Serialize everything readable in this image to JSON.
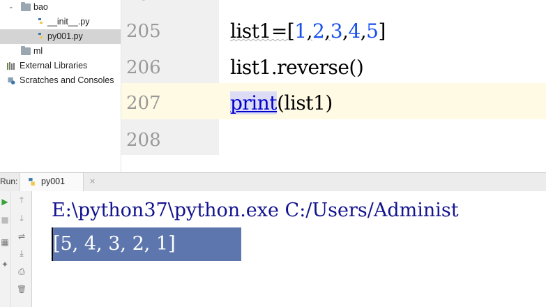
{
  "project_tree": {
    "items": [
      {
        "label": "bao",
        "kind": "folder"
      },
      {
        "label": "__init__.py",
        "kind": "py"
      },
      {
        "label": "py001.py",
        "kind": "py"
      },
      {
        "label": "ml",
        "kind": "folder"
      },
      {
        "label": "External Libraries",
        "kind": "libs"
      },
      {
        "label": "Scratches and Consoles",
        "kind": "scratch"
      }
    ]
  },
  "editor": {
    "lines": [
      {
        "number": "205",
        "tokens": [
          "list1=[",
          "1",
          ",",
          "2",
          ",",
          "3",
          ",",
          "4",
          ",",
          "5",
          "]"
        ]
      },
      {
        "number": "206",
        "text": "list1.reverse()"
      },
      {
        "number": "207",
        "builtin": "print",
        "rest": "(list1)"
      },
      {
        "number": "208",
        "text": ""
      }
    ],
    "colors": {
      "number": "#1750eb",
      "builtin": "#0000cc",
      "caret_line": "#fffae3"
    }
  },
  "run_window": {
    "label": "Run:",
    "tab_label": "py001",
    "tab_close": "×",
    "command": "E:\\python37\\python.exe C:/Users/Administ",
    "output": "[5, 4, 3, 2, 1]"
  },
  "icons": {
    "rerun": "▶",
    "stop": "■",
    "up": "↑",
    "down": "↓",
    "wrap": "⇌",
    "scroll_end": "⤓",
    "print": "⎙",
    "trash": "🗑"
  }
}
